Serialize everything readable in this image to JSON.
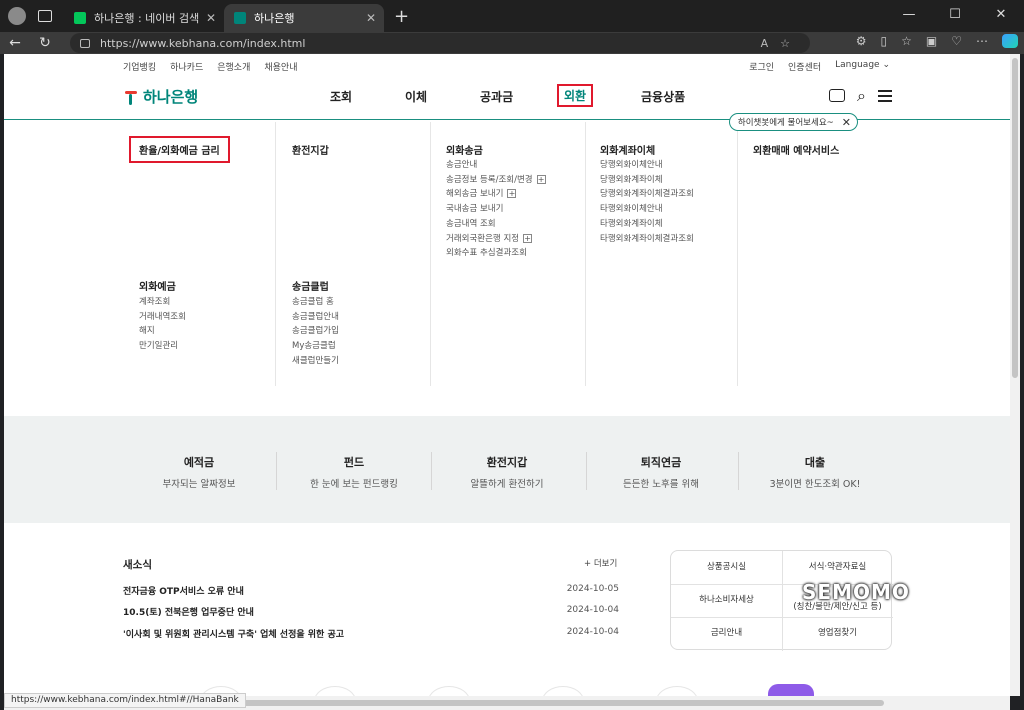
{
  "browser": {
    "tabs": [
      {
        "title": "하나은행 : 네이버 검색",
        "favicon_color": "#03c75a"
      },
      {
        "title": "하나은행",
        "favicon_color": "#00857a"
      }
    ],
    "url": "https://www.kebhana.com/index.html",
    "status_url": "https://www.kebhana.com/index.html#//HanaBank"
  },
  "utility": {
    "left": [
      "기업뱅킹",
      "하나카드",
      "은행소개",
      "채용안내"
    ],
    "right": [
      "로그인",
      "인증센터",
      "Language"
    ]
  },
  "logo": "하나은행",
  "gnb": {
    "items": [
      "조회",
      "이체",
      "공과금",
      "외환",
      "금융상품"
    ],
    "active": "외환"
  },
  "chatbot_tip": "하이챗봇에게 물어보세요~",
  "mega_menu": {
    "col1_title": "환율/외화예금 금리",
    "col1_sub_title": "외화예금",
    "col1_sub_items": [
      "계좌조회",
      "거래내역조회",
      "해지",
      "만기일관리"
    ],
    "col2_title": "환전지갑",
    "col2_sub_title": "송금클럽",
    "col2_sub_items": [
      "송금클럽 홈",
      "송금클럽안내",
      "송금클럽가입",
      "My송금클럽",
      "새클럽만들기"
    ],
    "col3_title": "외화송금",
    "col3_items": [
      "송금안내",
      "송금정보 등록/조회/변경",
      "해외송금 보내기",
      "국내송금 보내기",
      "송금내역 조회",
      "거래외국환은행 지정",
      "외화수표 추심결과조회"
    ],
    "col4_title": "외화계좌이체",
    "col4_items": [
      "당행외화이체안내",
      "당행외화계좌이체",
      "당행외화계좌이체결과조회",
      "타행외화이체안내",
      "타행외화계좌이체",
      "타행외화계좌이체결과조회"
    ],
    "col5_title": "외환매매 예약서비스"
  },
  "band": [
    {
      "title": "예적금",
      "desc": "부자되는 알짜정보"
    },
    {
      "title": "펀드",
      "desc": "한 눈에 보는 펀드랭킹"
    },
    {
      "title": "환전지갑",
      "desc": "알뜰하게 환전하기"
    },
    {
      "title": "퇴직연금",
      "desc": "든든한 노후를 위해"
    },
    {
      "title": "대출",
      "desc": "3분이면 한도조회 OK!"
    }
  ],
  "news": {
    "title": "새소식",
    "more": "+ 더보기",
    "items": [
      {
        "title": "전자금융 OTP서비스 오류 안내",
        "date": "2024-10-05"
      },
      {
        "title": "10.5(토) 전북은행 업무중단 안내",
        "date": "2024-10-04"
      },
      {
        "title": "'이사회 및 위원회 관리시스템 구축' 업체 선정을 위한 공고",
        "date": "2024-10-04"
      }
    ]
  },
  "quick_links": [
    "상품공시실",
    "서식·약관자료실",
    "하나소비자세상",
    "(칭찬/불만/제안/신고 등)",
    "금리안내",
    "영업점찾기"
  ],
  "watermark": "SEMOMO"
}
